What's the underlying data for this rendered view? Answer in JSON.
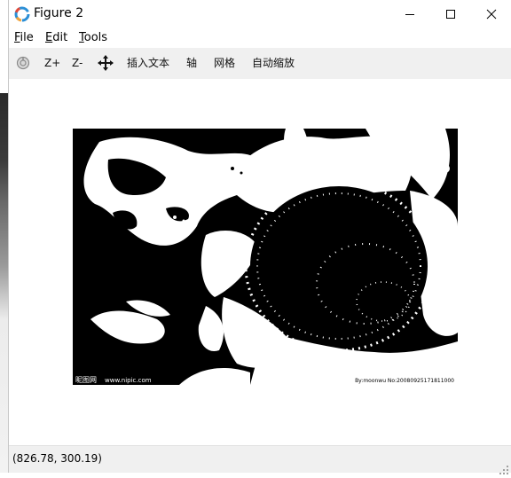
{
  "window": {
    "title": "Figure 2",
    "controls": {
      "minimize": "minimize-icon",
      "maximize": "maximize-icon",
      "close": "close-icon"
    }
  },
  "menu": {
    "items": [
      {
        "label": "File",
        "mnemonic": "F",
        "rest": "ile"
      },
      {
        "label": "Edit",
        "mnemonic": "E",
        "rest": "dit"
      },
      {
        "label": "Tools",
        "mnemonic": "T",
        "rest": "ools"
      }
    ]
  },
  "toolbar": {
    "home_icon": "home-icon",
    "zoom_in_label": "Z+",
    "zoom_out_label": "Z-",
    "pan_icon": "pan-icon",
    "insert_text_label": "插入文本",
    "axis_label": "轴",
    "grid_label": "网格",
    "autoscale_label": "自动缩放"
  },
  "figure": {
    "image_description_icon": "sunflower-binary-image",
    "watermark_left": "昵图网",
    "watermark_left_url": "www.nipic.com",
    "watermark_right": "By:moonwu      No:20080925171811000"
  },
  "status": {
    "coords": "(826.78, 300.19)"
  },
  "colors": {
    "titlebar_bg": "#ffffff",
    "toolbar_bg": "#f0f0f0",
    "status_bg": "#f0f0f0",
    "image_fg": "#ffffff",
    "image_bg": "#000000"
  }
}
